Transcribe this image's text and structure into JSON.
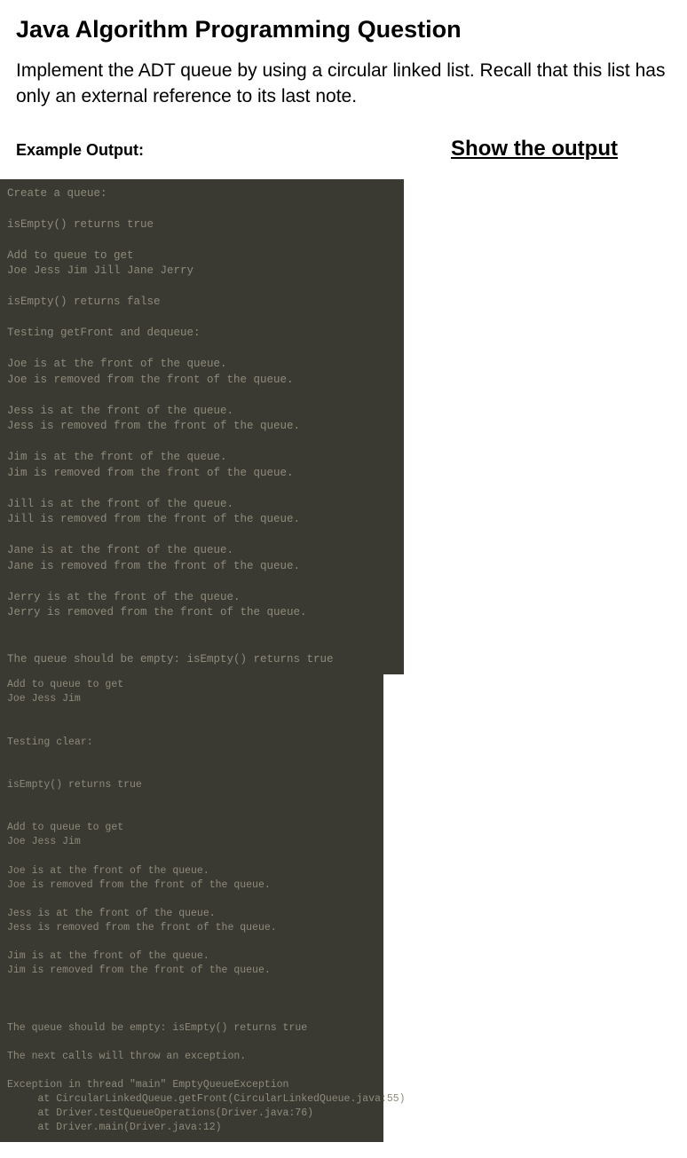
{
  "title": "Java Algorithm Programming Question",
  "description": "Implement the ADT queue by using a circular linked list. Recall that this list has only an external reference to its last note.",
  "example_label": "Example Output:",
  "show_output": "Show the output",
  "terminal_part1": "Create a queue:\n\nisEmpty() returns true\n\nAdd to queue to get\nJoe Jess Jim Jill Jane Jerry\n\nisEmpty() returns false\n\nTesting getFront and dequeue:\n\nJoe is at the front of the queue.\nJoe is removed from the front of the queue.\n\nJess is at the front of the queue.\nJess is removed from the front of the queue.\n\nJim is at the front of the queue.\nJim is removed from the front of the queue.\n\nJill is at the front of the queue.\nJill is removed from the front of the queue.\n\nJane is at the front of the queue.\nJane is removed from the front of the queue.\n\nJerry is at the front of the queue.\nJerry is removed from the front of the queue.\n\n\nThe queue should be empty: isEmpty() returns true\n",
  "terminal_part2": "Add to queue to get\nJoe Jess Jim\n\n\nTesting clear:\n\n\nisEmpty() returns true\n\n\nAdd to queue to get\nJoe Jess Jim\n\nJoe is at the front of the queue.\nJoe is removed from the front of the queue.\n\nJess is at the front of the queue.\nJess is removed from the front of the queue.\n\nJim is at the front of the queue.\nJim is removed from the front of the queue.\n\n\n\nThe queue should be empty: isEmpty() returns true\n\nThe next calls will throw an exception.\n\nException in thread \"main\" EmptyQueueException\n     at CircularLinkedQueue.getFront(CircularLinkedQueue.java:55)\n     at Driver.testQueueOperations(Driver.java:76)\n     at Driver.main(Driver.java:12)"
}
